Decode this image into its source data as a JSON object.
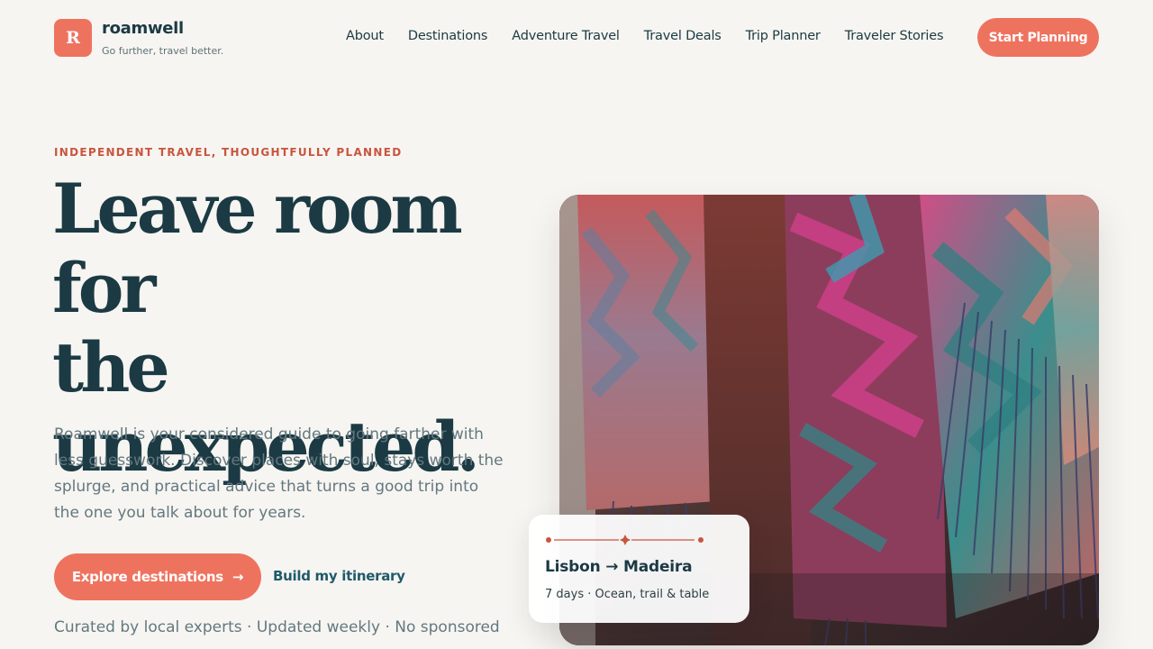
{
  "brand": {
    "logo_letter": "R",
    "name": "roamwell",
    "tagline": "Go further, travel better."
  },
  "nav": {
    "items": [
      "About",
      "Destinations",
      "Adventure Travel",
      "Travel Deals",
      "Trip Planner",
      "Traveler Stories"
    ],
    "cta_label": "Start Planning"
  },
  "hero": {
    "eyebrow": "INDEPENDENT TRAVEL, THOUGHTFULLY PLANNED",
    "headline_line1": "Leave room for",
    "headline_line2": "the",
    "headline_line3": "unexpected.",
    "lead": "Roamwell is your considered guide to going farther with less guesswork. Discover places with soul, stays worth the splurge, and practical advice that turns a good trip into the one you talk about for years.",
    "primary_label": "Explore destinations",
    "primary_arrow": "→",
    "secondary_label": "Build my itinerary",
    "trust_line": "Curated by local experts · Updated weekly · No sponsored"
  },
  "trip_card": {
    "title": "Lisbon → Madeira",
    "subtitle": "7 days · Ocean, trail & table"
  },
  "colors": {
    "accent": "#ee735f",
    "ink": "#1b3a44",
    "eyebrow": "#c8553f",
    "background": "#f7f5f1"
  }
}
